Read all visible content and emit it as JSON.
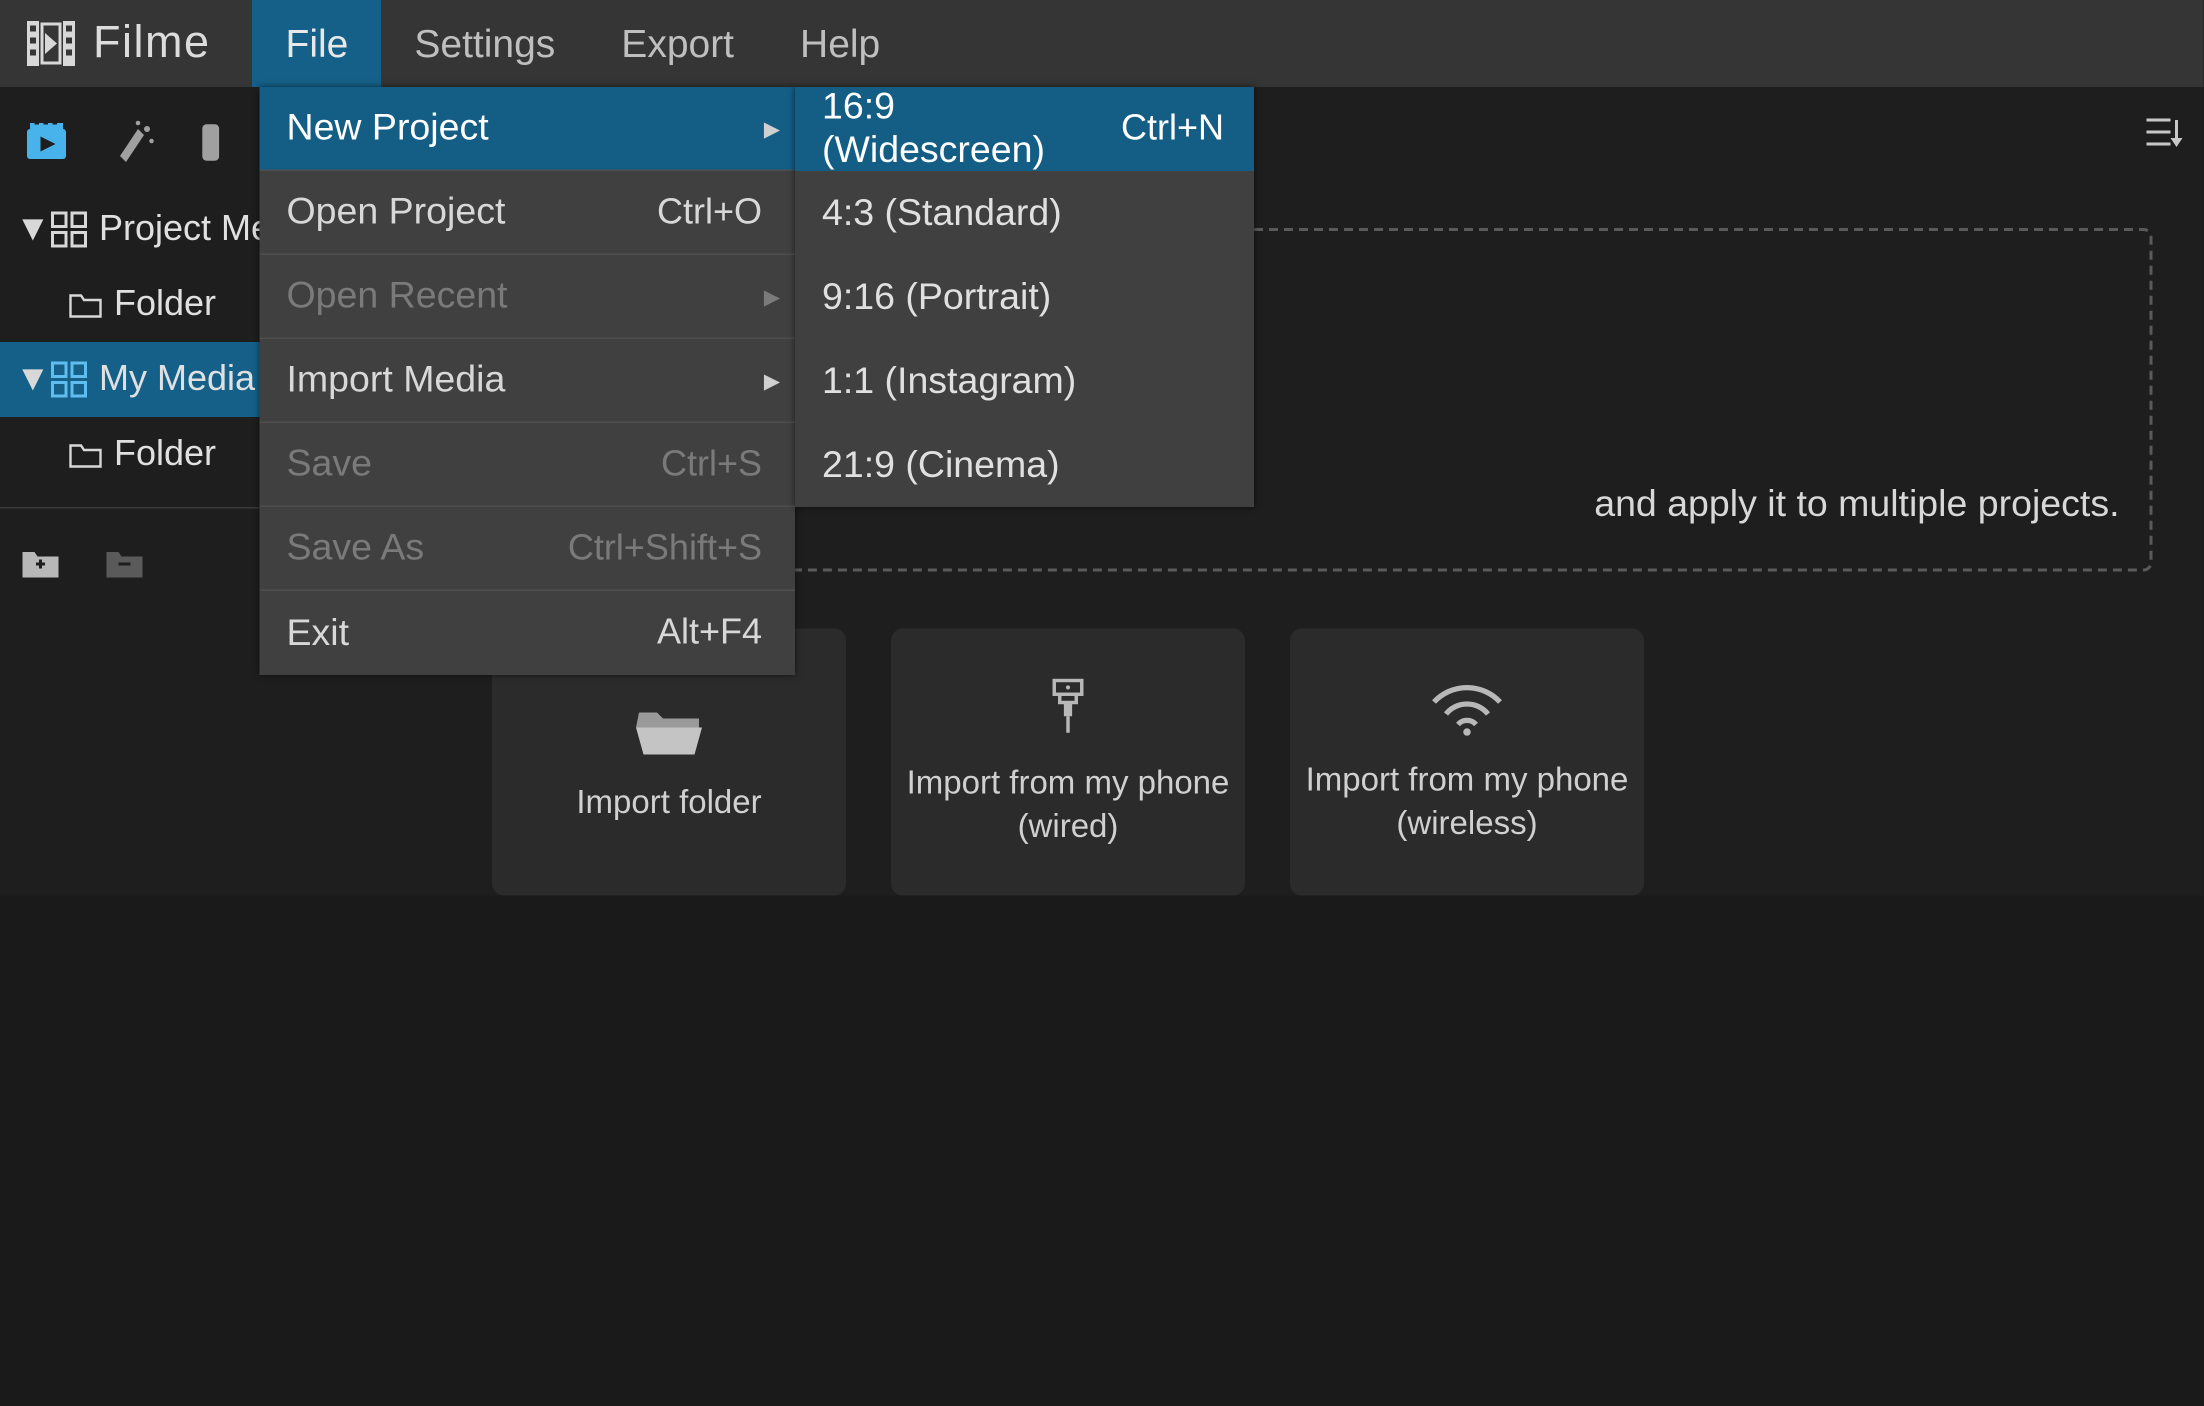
{
  "app": {
    "name": "Filme"
  },
  "menubar": {
    "file": "File",
    "settings": "Settings",
    "export": "Export",
    "help": "Help"
  },
  "fileMenu": {
    "newProject": {
      "label": "New Project"
    },
    "openProject": {
      "label": "Open Project",
      "shortcut": "Ctrl+O"
    },
    "openRecent": {
      "label": "Open Recent"
    },
    "importMedia": {
      "label": "Import Media"
    },
    "save": {
      "label": "Save",
      "shortcut": "Ctrl+S"
    },
    "saveAs": {
      "label": "Save As",
      "shortcut": "Ctrl+Shift+S"
    },
    "exit": {
      "label": "Exit",
      "shortcut": "Alt+F4"
    }
  },
  "newProjectMenu": {
    "r169": {
      "label": "16:9 (Widescreen)",
      "shortcut": "Ctrl+N"
    },
    "r43": {
      "label": "4:3 (Standard)"
    },
    "r916": {
      "label": "9:16 (Portrait)"
    },
    "r11": {
      "label": "1:1 (Instagram)"
    },
    "r219": {
      "label": "21:9 (Cinema)"
    }
  },
  "sidebar": {
    "projectMedia": "Project Media",
    "folder1": "Folder",
    "myMedia": "My Media",
    "folder2": "Folder"
  },
  "main": {
    "dropzoneTail": "and apply it to multiple projects.",
    "importFolder": "Import folder",
    "importWired": "Import from my phone (wired)",
    "importWireless": "Import from my phone (wireless)"
  }
}
